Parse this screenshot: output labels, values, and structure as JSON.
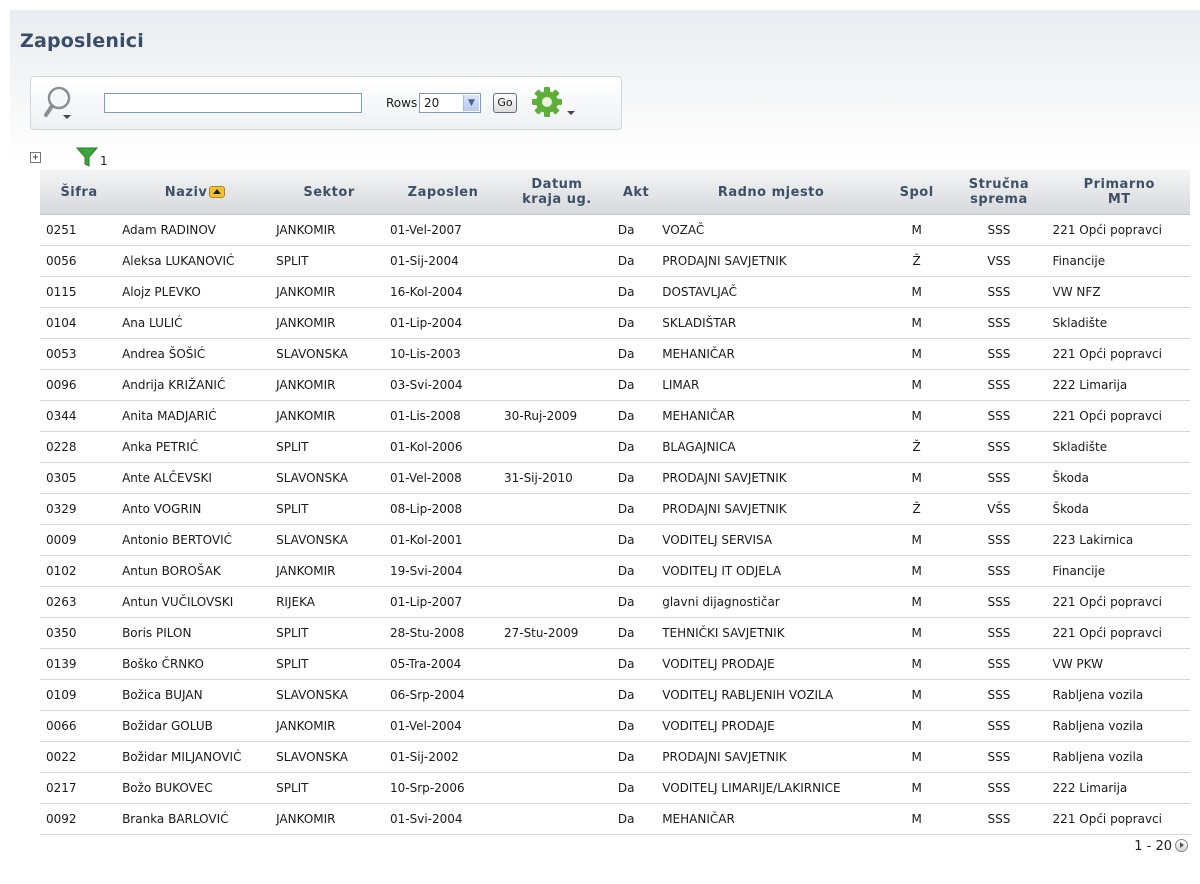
{
  "region": {
    "title": "Zaposlenici"
  },
  "search": {
    "value": "",
    "rows_label": "Rows",
    "rows_value": "20",
    "go_label": "Go"
  },
  "filters": {
    "count": "1"
  },
  "icons": {
    "search": "magnifier-icon",
    "actions": "gear-icon",
    "expand": "plus-box-icon",
    "filter": "funnel-icon",
    "sort": "sort-ascending-icon",
    "next": "next-page-icon"
  },
  "colors": {
    "header_text": "#3e5068",
    "title": "#3a4d68",
    "sort_icon": "#f2c233",
    "filter_icon": "#3aa63a"
  },
  "table": {
    "headers": {
      "sifra": "Šifra",
      "naziv": "Naziv",
      "sektor": "Sektor",
      "zaposlen": "Zaposlen",
      "datum1": "Datum",
      "datum2": "kraja ug.",
      "akt": "Akt",
      "radno": "Radno mjesto",
      "spol": "Spol",
      "strucna1": "Stručna",
      "strucna2": "sprema",
      "primarno1": "Primarno",
      "primarno2": "MT"
    },
    "rows": [
      {
        "sifra": "0251",
        "naziv": "Adam RADINOV",
        "sektor": "JANKOMIR",
        "zaposlen": "01-Vel-2007",
        "datum_kraja": "",
        "akt": "Da",
        "radno_mjesto": "VOZAČ",
        "spol": "M",
        "strucna_sprema": "SSS",
        "primarno_mt": "221 Opći popravci"
      },
      {
        "sifra": "0056",
        "naziv": "Aleksa LUKANOVIĆ",
        "sektor": "SPLIT",
        "zaposlen": "01-Sij-2004",
        "datum_kraja": "",
        "akt": "Da",
        "radno_mjesto": "PRODAJNI SAVJETNIK",
        "spol": "Ž",
        "strucna_sprema": "VSS",
        "primarno_mt": "Financije"
      },
      {
        "sifra": "0115",
        "naziv": "Alojz PLEVKO",
        "sektor": "JANKOMIR",
        "zaposlen": "16-Kol-2004",
        "datum_kraja": "",
        "akt": "Da",
        "radno_mjesto": "DOSTAVLJAČ",
        "spol": "M",
        "strucna_sprema": "SSS",
        "primarno_mt": "VW NFZ"
      },
      {
        "sifra": "0104",
        "naziv": "Ana LULIĆ",
        "sektor": "JANKOMIR",
        "zaposlen": "01-Lip-2004",
        "datum_kraja": "",
        "akt": "Da",
        "radno_mjesto": "SKLADIŠTAR",
        "spol": "M",
        "strucna_sprema": "SSS",
        "primarno_mt": "Skladište"
      },
      {
        "sifra": "0053",
        "naziv": "Andrea ŠOŠIĆ",
        "sektor": "SLAVONSKA",
        "zaposlen": "10-Lis-2003",
        "datum_kraja": "",
        "akt": "Da",
        "radno_mjesto": "MEHANIČAR",
        "spol": "M",
        "strucna_sprema": "SSS",
        "primarno_mt": "221 Opći popravci"
      },
      {
        "sifra": "0096",
        "naziv": "Andrija KRIŽANIĆ",
        "sektor": "JANKOMIR",
        "zaposlen": "03-Svi-2004",
        "datum_kraja": "",
        "akt": "Da",
        "radno_mjesto": "LIMAR",
        "spol": "M",
        "strucna_sprema": "SSS",
        "primarno_mt": "222 Limarija"
      },
      {
        "sifra": "0344",
        "naziv": "Anita MADJARIĆ",
        "sektor": "JANKOMIR",
        "zaposlen": "01-Lis-2008",
        "datum_kraja": "30-Ruj-2009",
        "akt": "Da",
        "radno_mjesto": "MEHANIČAR",
        "spol": "M",
        "strucna_sprema": "SSS",
        "primarno_mt": "221 Opći popravci"
      },
      {
        "sifra": "0228",
        "naziv": "Anka PETRIĆ",
        "sektor": "SPLIT",
        "zaposlen": "01-Kol-2006",
        "datum_kraja": "",
        "akt": "Da",
        "radno_mjesto": "BLAGAJNICA",
        "spol": "Ž",
        "strucna_sprema": "SSS",
        "primarno_mt": "Skladište"
      },
      {
        "sifra": "0305",
        "naziv": "Ante ALČEVSKI",
        "sektor": "SLAVONSKA",
        "zaposlen": "01-Vel-2008",
        "datum_kraja": "31-Sij-2010",
        "akt": "Da",
        "radno_mjesto": "PRODAJNI SAVJETNIK",
        "spol": "M",
        "strucna_sprema": "SSS",
        "primarno_mt": "Škoda"
      },
      {
        "sifra": "0329",
        "naziv": "Anto VOGRIN",
        "sektor": "SPLIT",
        "zaposlen": "08-Lip-2008",
        "datum_kraja": "",
        "akt": "Da",
        "radno_mjesto": "PRODAJNI SAVJETNIK",
        "spol": "Ž",
        "strucna_sprema": "VŠS",
        "primarno_mt": "Škoda"
      },
      {
        "sifra": "0009",
        "naziv": "Antonio BERTOVIĆ",
        "sektor": "SLAVONSKA",
        "zaposlen": "01-Kol-2001",
        "datum_kraja": "",
        "akt": "Da",
        "radno_mjesto": "VODITELJ SERVISA",
        "spol": "M",
        "strucna_sprema": "SSS",
        "primarno_mt": "223 Lakirnica"
      },
      {
        "sifra": "0102",
        "naziv": "Antun BOROŠAK",
        "sektor": "JANKOMIR",
        "zaposlen": "19-Svi-2004",
        "datum_kraja": "",
        "akt": "Da",
        "radno_mjesto": "VODITELJ IT ODJELA",
        "spol": "M",
        "strucna_sprema": "SSS",
        "primarno_mt": "Financije"
      },
      {
        "sifra": "0263",
        "naziv": "Antun VUČILOVSKI",
        "sektor": "RIJEKA",
        "zaposlen": "01-Lip-2007",
        "datum_kraja": "",
        "akt": "Da",
        "radno_mjesto": "glavni dijagnostičar",
        "spol": "M",
        "strucna_sprema": "SSS",
        "primarno_mt": "221 Opći popravci"
      },
      {
        "sifra": "0350",
        "naziv": "Boris PILON",
        "sektor": "SPLIT",
        "zaposlen": "28-Stu-2008",
        "datum_kraja": "27-Stu-2009",
        "akt": "Da",
        "radno_mjesto": "TEHNIČKI SAVJETNIK",
        "spol": "M",
        "strucna_sprema": "SSS",
        "primarno_mt": "221 Opći popravci"
      },
      {
        "sifra": "0139",
        "naziv": "Boško ČRNKO",
        "sektor": "SPLIT",
        "zaposlen": "05-Tra-2004",
        "datum_kraja": "",
        "akt": "Da",
        "radno_mjesto": "VODITELJ PRODAJE",
        "spol": "M",
        "strucna_sprema": "SSS",
        "primarno_mt": "VW PKW"
      },
      {
        "sifra": "0109",
        "naziv": "Božica BUJAN",
        "sektor": "SLAVONSKA",
        "zaposlen": "06-Srp-2004",
        "datum_kraja": "",
        "akt": "Da",
        "radno_mjesto": "VODITELJ RABLJENIH VOZILA",
        "spol": "M",
        "strucna_sprema": "SSS",
        "primarno_mt": "Rabljena vozila"
      },
      {
        "sifra": "0066",
        "naziv": "Božidar GOLUB",
        "sektor": "JANKOMIR",
        "zaposlen": "01-Vel-2004",
        "datum_kraja": "",
        "akt": "Da",
        "radno_mjesto": "VODITELJ PRODAJE",
        "spol": "M",
        "strucna_sprema": "SSS",
        "primarno_mt": "Rabljena vozila"
      },
      {
        "sifra": "0022",
        "naziv": "Božidar MILJANOVIĆ",
        "sektor": "SLAVONSKA",
        "zaposlen": "01-Sij-2002",
        "datum_kraja": "",
        "akt": "Da",
        "radno_mjesto": "PRODAJNI SAVJETNIK",
        "spol": "M",
        "strucna_sprema": "SSS",
        "primarno_mt": "Rabljena vozila"
      },
      {
        "sifra": "0217",
        "naziv": "Božo BUKOVEC",
        "sektor": "SPLIT",
        "zaposlen": "10-Srp-2006",
        "datum_kraja": "",
        "akt": "Da",
        "radno_mjesto": "VODITELJ LIMARIJE/LAKIRNICE",
        "spol": "M",
        "strucna_sprema": "SSS",
        "primarno_mt": "222 Limarija"
      },
      {
        "sifra": "0092",
        "naziv": "Branka BARLOVIĆ",
        "sektor": "JANKOMIR",
        "zaposlen": "01-Svi-2004",
        "datum_kraja": "",
        "akt": "Da",
        "radno_mjesto": "MEHANIČAR",
        "spol": "M",
        "strucna_sprema": "SSS",
        "primarno_mt": "221 Opći popravci"
      }
    ]
  },
  "pagination": {
    "range": "1 - 20"
  }
}
